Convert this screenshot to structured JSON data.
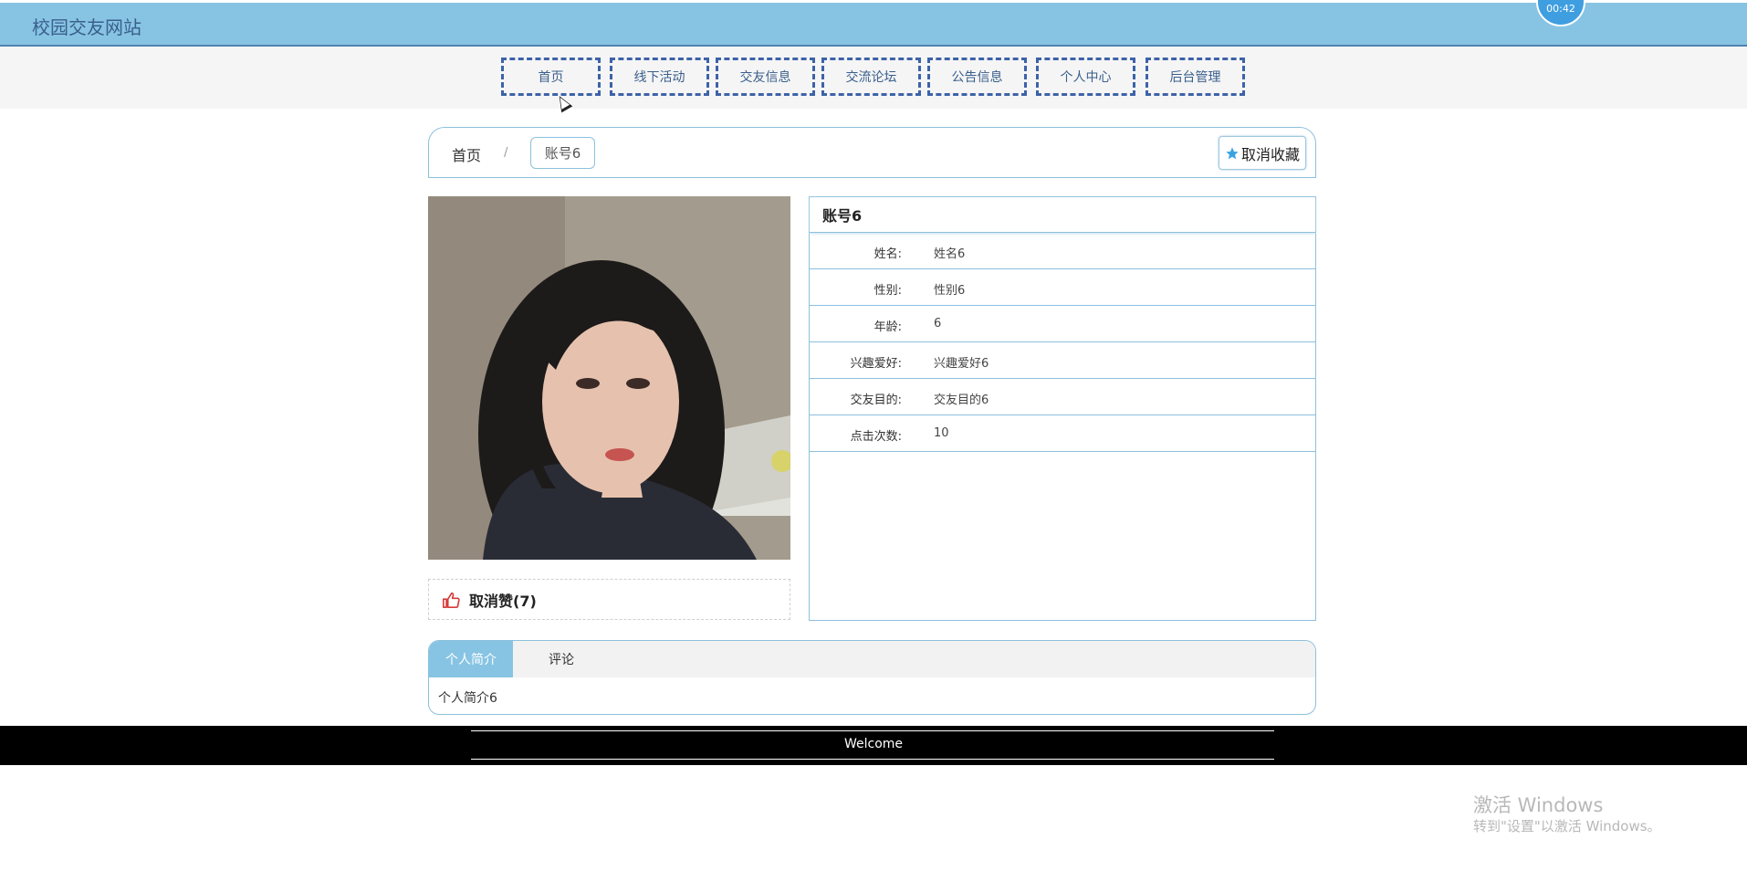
{
  "header": {
    "site_title": "校园交友网站",
    "clock_text": "00:42"
  },
  "nav": {
    "items": [
      "首页",
      "线下活动",
      "交友信息",
      "交流论坛",
      "公告信息",
      "个人中心",
      "后台管理"
    ]
  },
  "breadcrumb": {
    "home": "首页",
    "separator": "/",
    "current": "账号6"
  },
  "actions": {
    "favorite_label": "取消收藏",
    "like_label": "取消赞(7)"
  },
  "profile": {
    "title": "账号6",
    "fields": [
      {
        "label": "姓名:",
        "value": "姓名6"
      },
      {
        "label": "性别:",
        "value": "性别6"
      },
      {
        "label": "年龄:",
        "value": "6"
      },
      {
        "label": "兴趣爱好:",
        "value": "兴趣爱好6"
      },
      {
        "label": "交友目的:",
        "value": "交友目的6"
      },
      {
        "label": "点击次数:",
        "value": "10"
      }
    ]
  },
  "tabs": {
    "items": [
      "个人简介",
      "评论"
    ],
    "active": "个人简介",
    "content": "个人简介6"
  },
  "footer": {
    "text": "Welcome"
  },
  "watermark": {
    "line1": "激活 Windows",
    "line2": "转到\"设置\"以激活 Windows。"
  },
  "colors": {
    "header_bg": "#87c4e3",
    "nav_border": "#3d62a8",
    "accent_border": "#8cc0dd",
    "like_icon": "#d63b3b",
    "star_icon": "#3aa3e0",
    "footer_bg": "#000000"
  },
  "icons": {
    "like": "thumbs-up-icon",
    "favorite": "star-icon",
    "cursor": "mouse-pointer"
  }
}
